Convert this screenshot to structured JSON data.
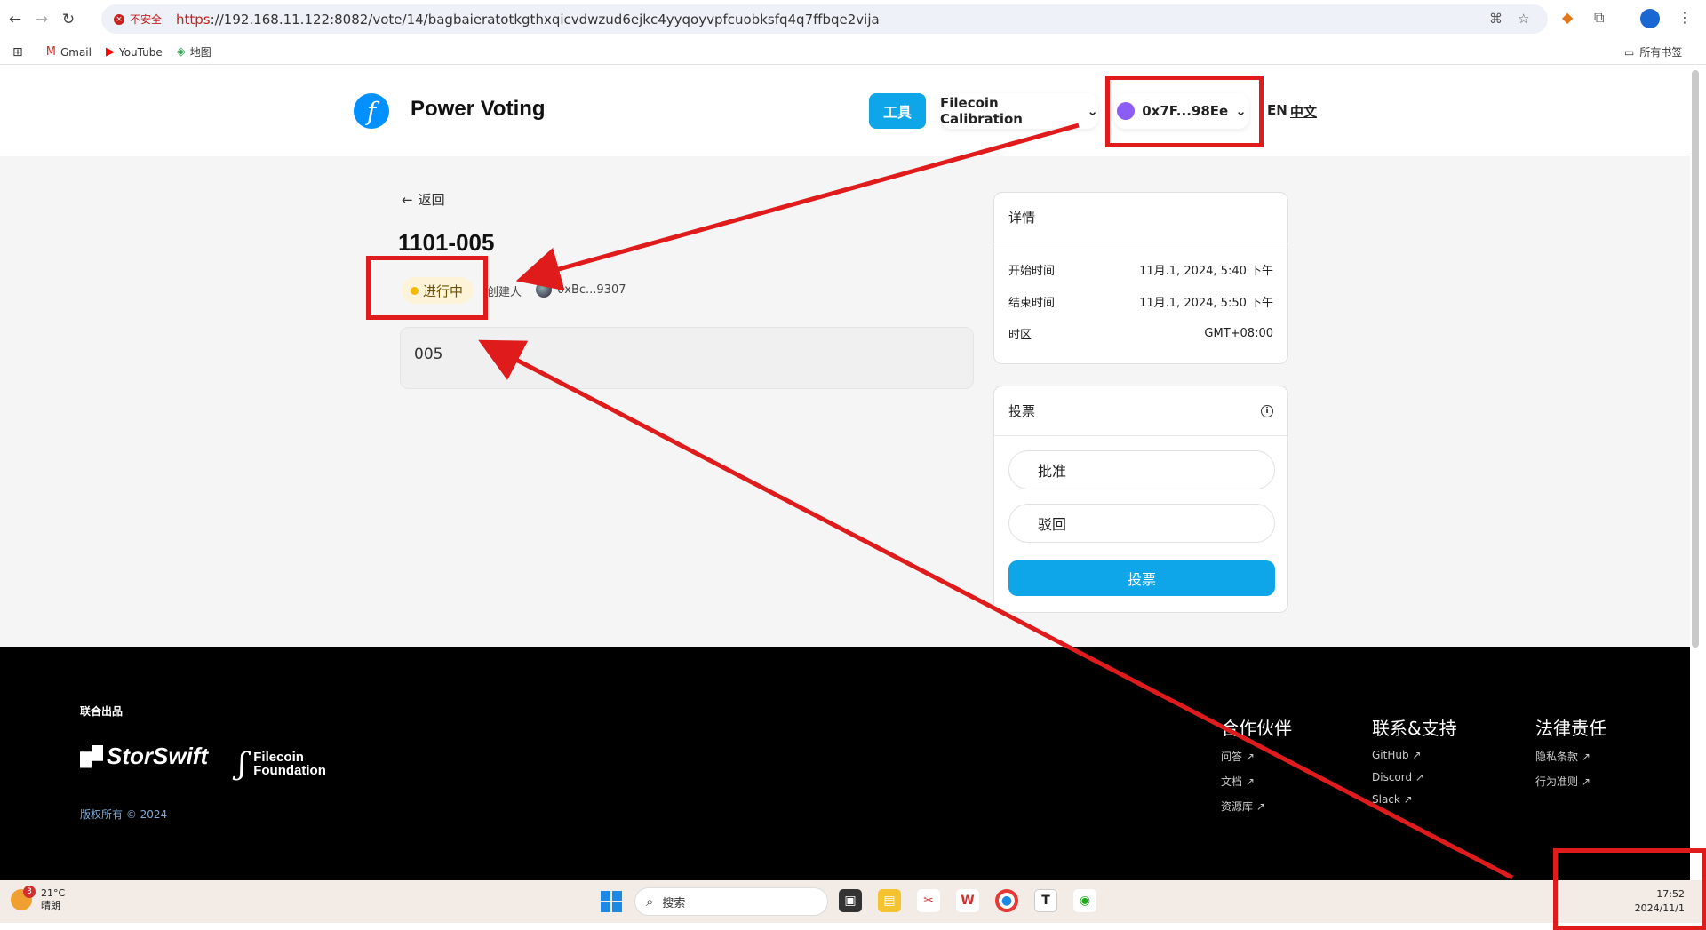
{
  "browser": {
    "security_label": "不安全",
    "url_scheme": "https",
    "url_rest": "://192.168.11.122:8082/vote/14/bagbaieratotkgthxqicvdwzud6ejkc4yyqoyvpfcuobksfq4q7ffbqe2vija",
    "bookmarks": [
      {
        "label": "Gmail",
        "icon": "gmail-icon"
      },
      {
        "label": "YouTube",
        "icon": "youtube-icon"
      },
      {
        "label": "地图",
        "icon": "maps-icon"
      }
    ],
    "all_bookmarks": "所有书签"
  },
  "header": {
    "brand": "Power Voting",
    "tools": "工具",
    "network": "Filecoin Calibration",
    "wallet": "0x7F...98Ee",
    "lang_en": "EN",
    "lang_zh": "中文"
  },
  "proposal": {
    "back": "返回",
    "title": "1101-005",
    "status": "进行中",
    "creator_label": "创建人",
    "creator_address": "0xBc...9307",
    "description": "005"
  },
  "details": {
    "title": "详情",
    "rows": [
      {
        "label": "开始时间",
        "value": "11月.1, 2024, 5:40 下午"
      },
      {
        "label": "结束时间",
        "value": "11月.1, 2024, 5:50 下午"
      },
      {
        "label": "时区",
        "value": "GMT+08:00"
      }
    ]
  },
  "vote": {
    "title": "投票",
    "options": [
      "批准",
      "驳回"
    ],
    "submit": "投票"
  },
  "footer": {
    "joint": "联合出品",
    "storswift": "StorSwift",
    "ff_line1": "Filecoin",
    "ff_line2": "Foundation",
    "copyright": "版权所有 © 2024",
    "columns": [
      {
        "title": "合作伙伴",
        "links": [
          "问答 ↗",
          "文档 ↗",
          "资源库 ↗"
        ]
      },
      {
        "title": "联系&支持",
        "links": [
          "GitHub ↗",
          "Discord ↗",
          "Slack ↗"
        ]
      },
      {
        "title": "法律责任",
        "links": [
          "隐私条款 ↗",
          "行为准则 ↗"
        ]
      }
    ]
  },
  "taskbar": {
    "temperature": "21°C",
    "weather": "晴朗",
    "weather_badge": "3",
    "search": "搜索",
    "time": "17:52",
    "date": "2024/11/1"
  },
  "colors": {
    "accent": "#0ea5e9",
    "annotation": "#e01b1b",
    "status_bg": "#fdf3d8"
  }
}
